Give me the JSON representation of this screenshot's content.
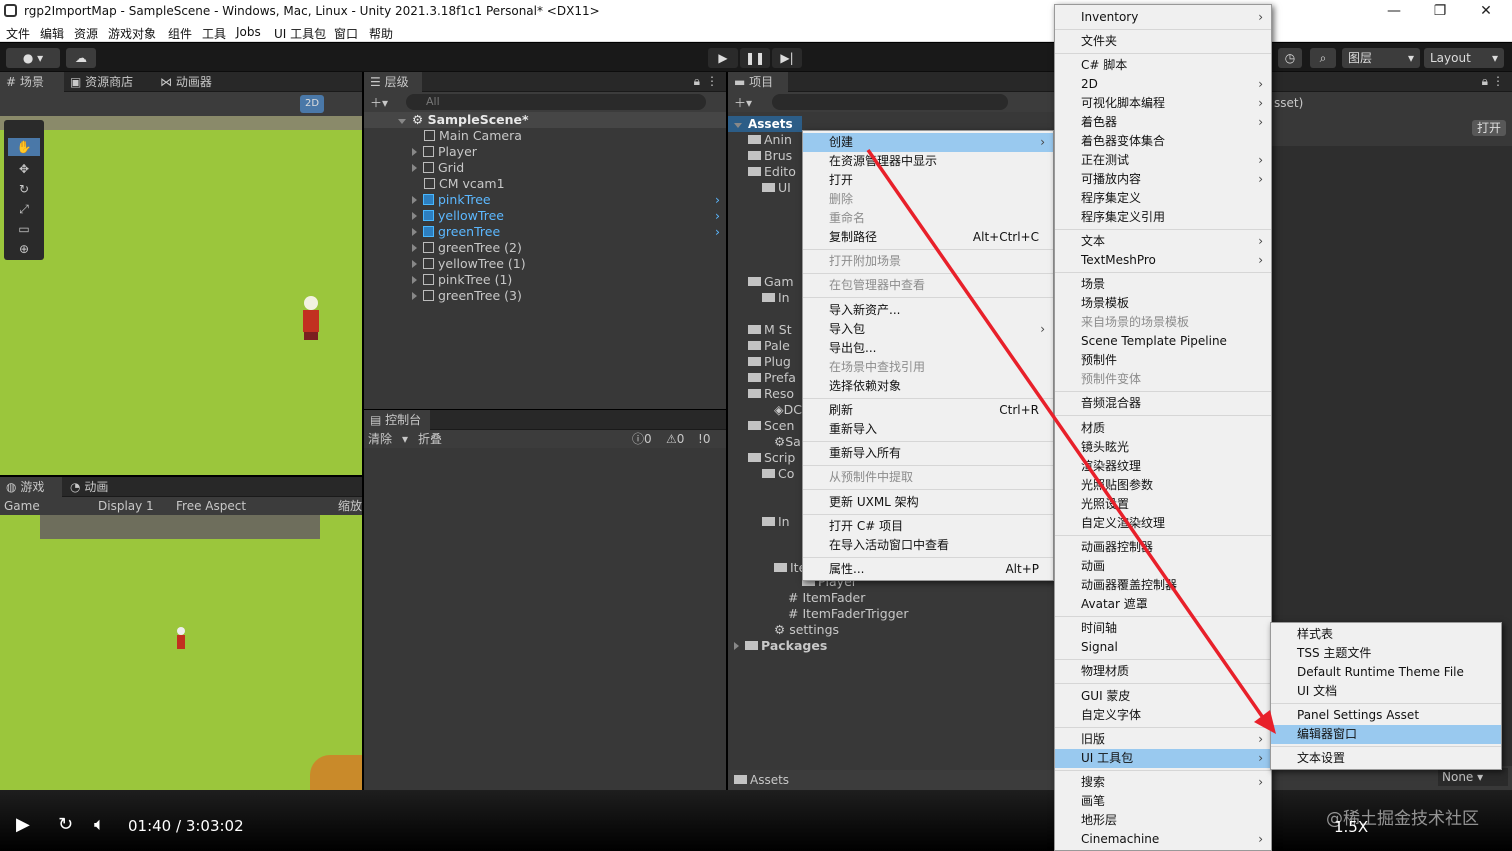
{
  "window": {
    "title": "rgp2ImportMap - SampleScene - Windows, Mac, Linux - Unity 2021.3.18f1c1 Personal* <DX11>",
    "minimize": "—",
    "maximize": "❐",
    "close": "✕"
  },
  "menubar": [
    "文件",
    "编辑",
    "资源",
    "游戏对象",
    "组件",
    "工具",
    "Jobs",
    "UI 工具包",
    "窗口",
    "帮助"
  ],
  "toolbar": {
    "account": "●",
    "layers": "图层",
    "layout": "Layout",
    "twod": "2D"
  },
  "scene_tabs": {
    "scene": "场景",
    "store": "资源商店",
    "animator": "动画器"
  },
  "hierarchy": {
    "tab": "层级",
    "search": "All",
    "items": [
      {
        "label": "SampleScene*",
        "kind": "scene"
      },
      {
        "label": "Main Camera",
        "kind": "go"
      },
      {
        "label": "Player",
        "kind": "go"
      },
      {
        "label": "Grid",
        "kind": "go"
      },
      {
        "label": "CM vcam1",
        "kind": "go"
      },
      {
        "label": "pinkTree",
        "kind": "prefab"
      },
      {
        "label": "yellowTree",
        "kind": "prefab"
      },
      {
        "label": "greenTree",
        "kind": "prefab"
      },
      {
        "label": "greenTree (2)",
        "kind": "go"
      },
      {
        "label": "yellowTree (1)",
        "kind": "go"
      },
      {
        "label": "pinkTree (1)",
        "kind": "go"
      },
      {
        "label": "greenTree (3)",
        "kind": "go"
      }
    ]
  },
  "console": {
    "tab": "控制台",
    "clear": "清除",
    "collapse": "折叠",
    "counts": [
      "0",
      "0",
      "0"
    ]
  },
  "game": {
    "tab_game": "游戏",
    "tab_anim": "动画",
    "game_label": "Game",
    "display": "Display 1",
    "aspect": "Free Aspect",
    "scale": "缩放"
  },
  "project": {
    "tab": "项目",
    "assets_root": "Assets",
    "footer": "Assets",
    "tree": [
      "Anin",
      "Brus",
      "Edito",
      "UI",
      "Gam",
      "In",
      "M St",
      "Pale",
      "Plug",
      "Prefa",
      "Reso",
      "DC",
      "Scen",
      "Sa",
      "Scrip",
      "Co",
      "In",
      "Ite",
      "Player",
      "ItemFader",
      "ItemFaderTrigger",
      "settings",
      "Packages"
    ]
  },
  "inspector": {
    "asset": "sset)",
    "open": "打开",
    "none": "None"
  },
  "context_menu": [
    {
      "label": "创建",
      "arrow": true,
      "hl": true
    },
    {
      "label": "在资源管理器中显示"
    },
    {
      "label": "打开"
    },
    {
      "label": "删除",
      "dis": true
    },
    {
      "label": "重命名",
      "dis": true
    },
    {
      "label": "复制路径",
      "shortcut": "Alt+Ctrl+C"
    },
    {
      "label": "打开附加场景",
      "dis": true,
      "sep": true
    },
    {
      "label": "在包管理器中查看",
      "dis": true,
      "sep": true
    },
    {
      "label": "导入新资产...",
      "sep": true
    },
    {
      "label": "导入包",
      "arrow": true
    },
    {
      "label": "导出包..."
    },
    {
      "label": "在场景中查找引用",
      "dis": true
    },
    {
      "label": "选择依赖对象"
    },
    {
      "label": "刷新",
      "shortcut": "Ctrl+R",
      "sep": true
    },
    {
      "label": "重新导入"
    },
    {
      "label": "重新导入所有",
      "sep": true
    },
    {
      "label": "从预制件中提取",
      "dis": true,
      "sep": true
    },
    {
      "label": "更新 UXML 架构",
      "sep": true
    },
    {
      "label": "打开 C# 项目",
      "sep": true
    },
    {
      "label": "在导入活动窗口中查看"
    },
    {
      "label": "属性...",
      "shortcut": "Alt+P",
      "sep": true
    }
  ],
  "create_menu": [
    {
      "label": "Inventory",
      "arrow": true
    },
    {
      "label": "文件夹",
      "sep": true
    },
    {
      "label": "C# 脚本",
      "sep": true
    },
    {
      "label": "2D",
      "arrow": true
    },
    {
      "label": "可视化脚本编程",
      "arrow": true
    },
    {
      "label": "着色器",
      "arrow": true
    },
    {
      "label": "着色器变体集合"
    },
    {
      "label": "正在测试",
      "arrow": true
    },
    {
      "label": "可播放内容",
      "arrow": true
    },
    {
      "label": "程序集定义"
    },
    {
      "label": "程序集定义引用"
    },
    {
      "label": "文本",
      "arrow": true,
      "sep": true
    },
    {
      "label": "TextMeshPro",
      "arrow": true
    },
    {
      "label": "场景",
      "sep": true
    },
    {
      "label": "场景模板"
    },
    {
      "label": "来自场景的场景模板",
      "dis": true
    },
    {
      "label": "Scene Template Pipeline"
    },
    {
      "label": "预制件"
    },
    {
      "label": "预制件变体",
      "dis": true
    },
    {
      "label": "音频混合器",
      "sep": true
    },
    {
      "label": "材质",
      "sep": true
    },
    {
      "label": "镜头眩光"
    },
    {
      "label": "渲染器纹理"
    },
    {
      "label": "光照贴图参数"
    },
    {
      "label": "光照设置"
    },
    {
      "label": "自定义渲染纹理"
    },
    {
      "label": "动画器控制器",
      "sep": true
    },
    {
      "label": "动画"
    },
    {
      "label": "动画器覆盖控制器"
    },
    {
      "label": "Avatar 遮罩"
    },
    {
      "label": "时间轴",
      "sep": true
    },
    {
      "label": "Signal"
    },
    {
      "label": "物理材质",
      "sep": true
    },
    {
      "label": "GUI 蒙皮",
      "sep": true
    },
    {
      "label": "自定义字体"
    },
    {
      "label": "旧版",
      "arrow": true,
      "sep": true
    },
    {
      "label": "UI 工具包",
      "arrow": true,
      "hl": true
    },
    {
      "label": "搜索",
      "arrow": true,
      "sep": true
    },
    {
      "label": "画笔"
    },
    {
      "label": "地形层"
    },
    {
      "label": "Cinemachine",
      "arrow": true
    }
  ],
  "uitk_menu": [
    {
      "label": "样式表"
    },
    {
      "label": "TSS 主题文件"
    },
    {
      "label": "Default Runtime Theme File"
    },
    {
      "label": "UI 文档"
    },
    {
      "label": "Panel Settings Asset",
      "sep": true
    },
    {
      "label": "编辑器窗口",
      "hl": true
    },
    {
      "label": "文本设置",
      "sep": true
    }
  ],
  "video": {
    "time": "01:40 / 3:03:02",
    "speed": "1.5X"
  },
  "watermark": "@稀土掘金技术社区",
  "colors": {
    "arrow": "#e8202a",
    "highlight": "#99c9ef",
    "grass": "#9bc63c",
    "selection": "#2c5d87"
  }
}
